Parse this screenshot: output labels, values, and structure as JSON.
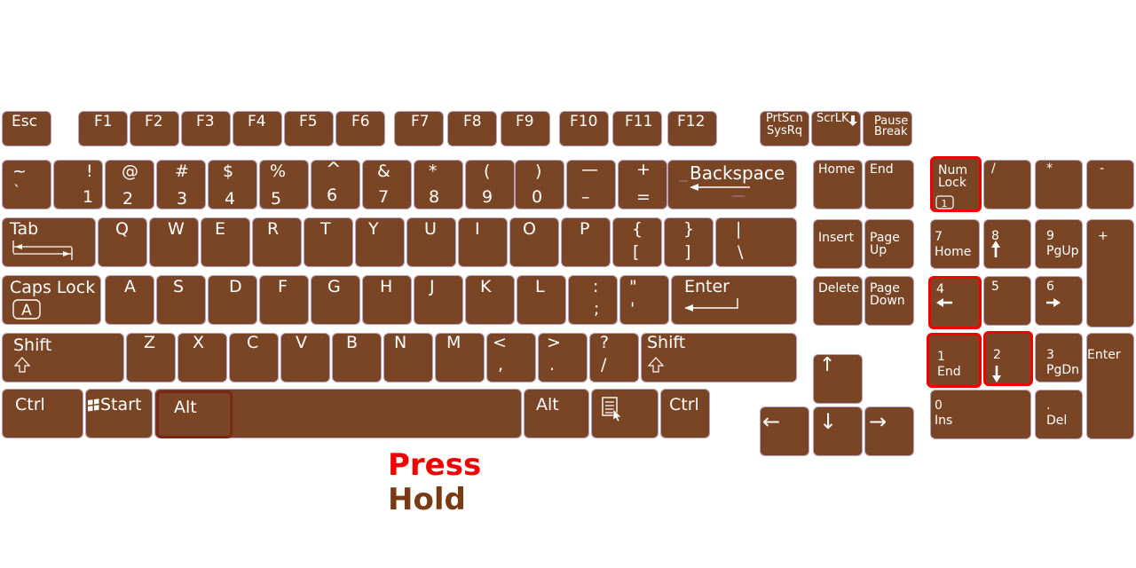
{
  "colors": {
    "key": "#7a4524",
    "key_border": "#b7a3bf",
    "press": "#f20000",
    "hold": "#7a3a14",
    "text": "#ffffff"
  },
  "legend": {
    "press": "Press",
    "hold": "Hold"
  },
  "keys": {
    "esc": "Esc",
    "f1": "F1",
    "f2": "F2",
    "f3": "F3",
    "f4": "F4",
    "f5": "F5",
    "f6": "F6",
    "f7": "F7",
    "f8": "F8",
    "f9": "F9",
    "f10": "F10",
    "f11": "F11",
    "f12": "F12",
    "prtscn": "PrtScn",
    "sysrq": "SysRq",
    "scrlk": "ScrLK",
    "pause": "Pause",
    "break": "Break",
    "tilde_top": "~",
    "tilde_bottom": "`",
    "n1_top": "!",
    "n1_bottom": "1",
    "n2_top": "@",
    "n2_bottom": "2",
    "n3_top": "#",
    "n3_bottom": "3",
    "n4_top": "$",
    "n4_bottom": "4",
    "n5_top": "%",
    "n5_bottom": "5",
    "n6_top": "^",
    "n6_bottom": "6",
    "n7_top": "&",
    "n7_bottom": "7",
    "n8_top": "*",
    "n8_bottom": "8",
    "n9_top": "(",
    "n9_bottom": "9",
    "n0_top": ")",
    "n0_bottom": "0",
    "minus_top": "—",
    "minus_bottom": "–",
    "plus_top": "+",
    "plus_bottom": "=",
    "backspace": "Backspace",
    "home": "Home",
    "end": "End",
    "numlock": "Num\nLock",
    "numlock_icon": "1",
    "np_slash": "/",
    "np_star": "*",
    "np_minus": "-",
    "tab": "Tab",
    "q": "Q",
    "w": "W",
    "e": "E",
    "r": "R",
    "t": "T",
    "y": "Y",
    "u": "U",
    "i": "I",
    "o": "O",
    "p": "P",
    "lbrace_top": "{",
    "lbrace_bottom": "[",
    "rbrace_top": "}",
    "rbrace_bottom": "]",
    "pipe_top": "|",
    "pipe_bottom": "\\",
    "insert": "Insert",
    "pageup": "Page\nUp",
    "np7_num": "7",
    "np7_label": "Home",
    "np8_num": "8",
    "np9_num": "9",
    "np9_label": "PgUp",
    "np_plus": "+",
    "capslock": "Caps Lock",
    "capslock_icon": "A",
    "a": "A",
    "s": "S",
    "d": "D",
    "f": "F",
    "g": "G",
    "h": "H",
    "j": "J",
    "k": "K",
    "l": "L",
    "colon_top": ":",
    "colon_bottom": ";",
    "quote_top": "\"",
    "quote_bottom": "'",
    "enter": "Enter",
    "delete": "Delete",
    "pagedown": "Page\nDown",
    "np4_num": "4",
    "np5_num": "5",
    "np6_num": "6",
    "shift": "Shift",
    "z": "Z",
    "x": "X",
    "c": "C",
    "v": "V",
    "b": "B",
    "n": "N",
    "m": "M",
    "lt_top": "<",
    "lt_bottom": ",",
    "gt_top": ">",
    "gt_bottom": ".",
    "q_top": "?",
    "q_bottom": "/",
    "np1_num": "1",
    "np1_label": "End",
    "np2_num": "2",
    "np3_num": "3",
    "np3_label": "PgDn",
    "np_enter": "Enter",
    "ctrl": "Ctrl",
    "start": "Start",
    "alt": "Alt",
    "np0_num": "0",
    "np0_label": "Ins",
    "npdot_num": ".",
    "npdot_label": "Del",
    "arrow_up": "↑",
    "arrow_down": "↓",
    "arrow_left": "←",
    "arrow_right": "→",
    "shift_icon": "⇧"
  }
}
